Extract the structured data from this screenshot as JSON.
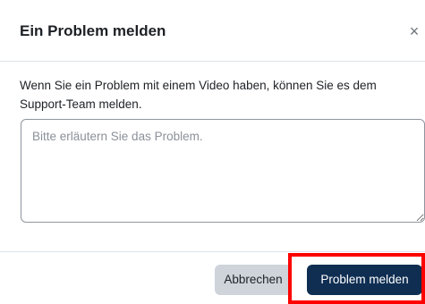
{
  "dialog": {
    "title": "Ein Problem melden",
    "close_glyph": "×",
    "close_icon": "close-icon"
  },
  "body": {
    "intro": "Wenn Sie ein Problem mit einem Video haben, können Sie es dem Support-Team melden.",
    "textarea_value": "",
    "textarea_placeholder": "Bitte erläutern Sie das Problem."
  },
  "footer": {
    "cancel_label": "Abbrechen",
    "submit_label": "Problem melden"
  },
  "colors": {
    "primary_button": "#0f2e52",
    "cancel_button": "#ced4da",
    "highlight": "#ff0000"
  }
}
